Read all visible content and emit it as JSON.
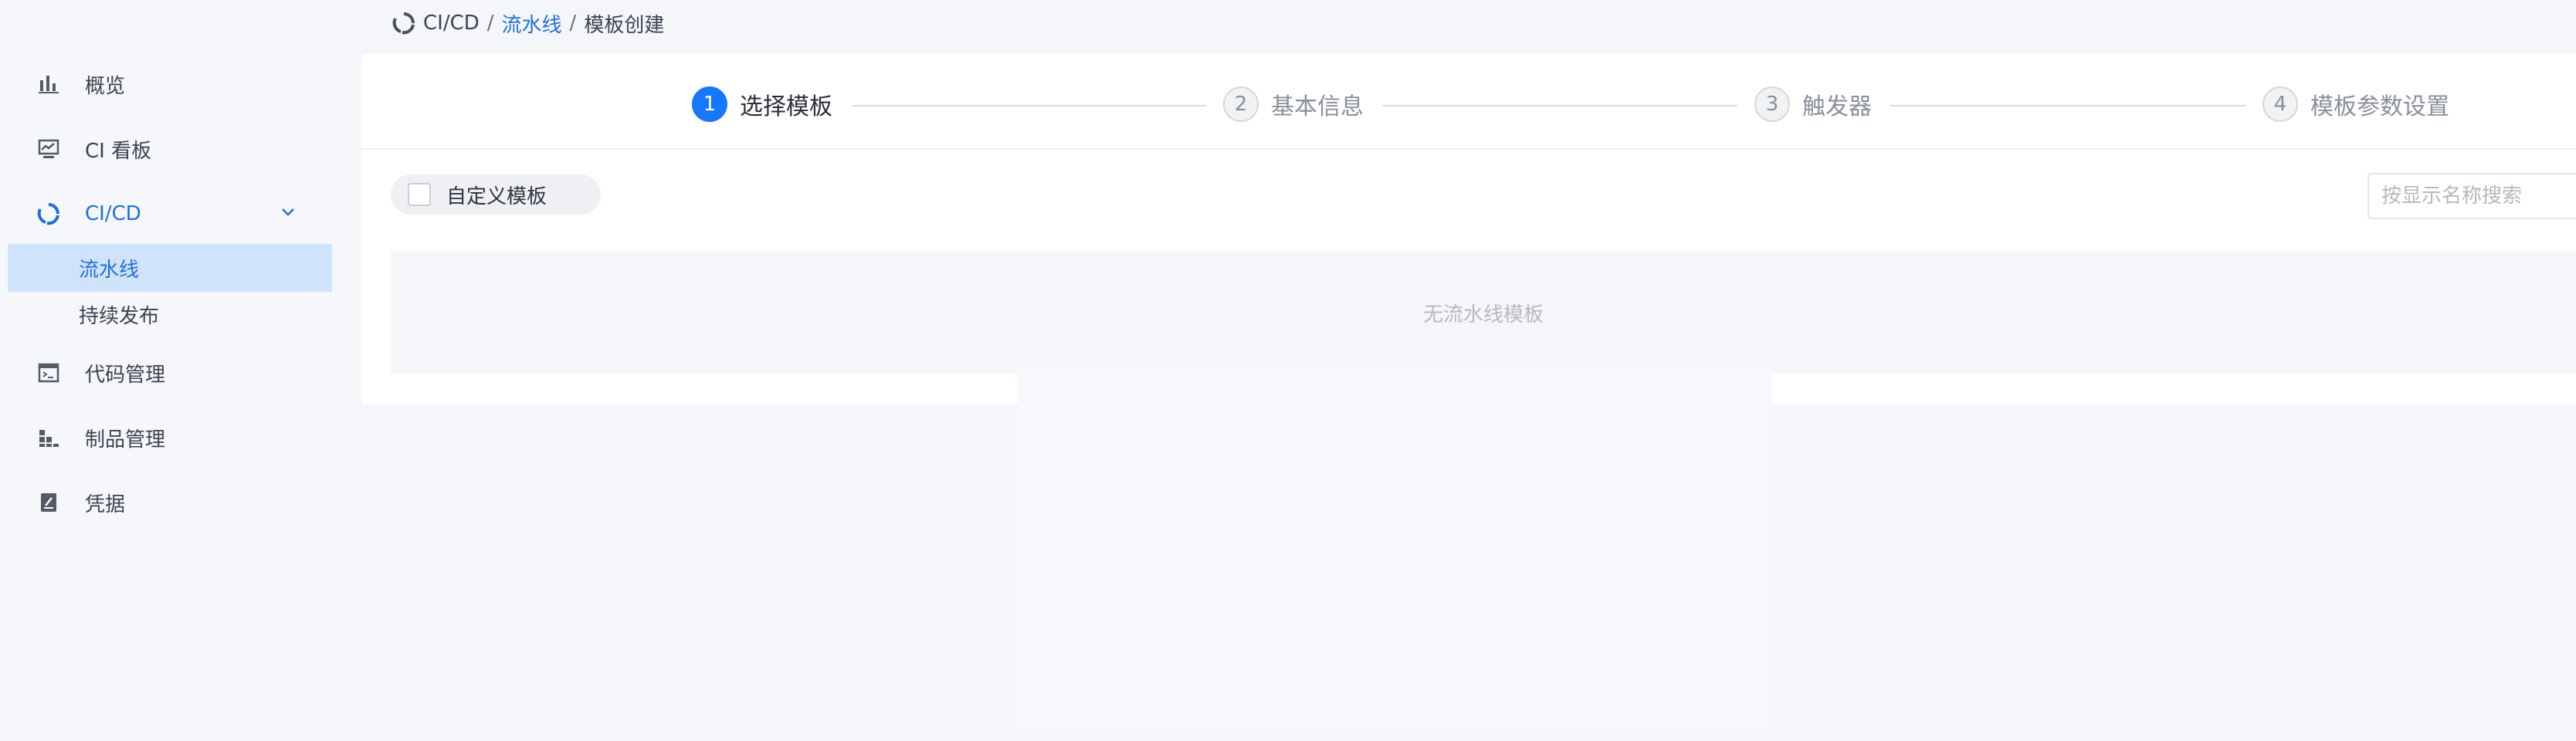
{
  "breadcrumb": {
    "root": "CI/CD",
    "sep": "/",
    "pipelines": "流水线",
    "current": "模板创建"
  },
  "sidebar": {
    "items": [
      {
        "label": "概览",
        "icon": "bar-chart-icon"
      },
      {
        "label": "CI 看板",
        "icon": "dashboard-icon"
      },
      {
        "label": "CI/CD",
        "icon": "cicd-ring-icon",
        "expanded": true
      },
      {
        "label": "代码管理",
        "icon": "terminal-icon"
      },
      {
        "label": "制品管理",
        "icon": "artifact-blocks-icon"
      },
      {
        "label": "凭据",
        "icon": "credential-icon"
      }
    ],
    "subitems": [
      {
        "label": "流水线",
        "active": true
      },
      {
        "label": "持续发布",
        "active": false
      }
    ]
  },
  "steps": [
    {
      "num": "1",
      "label": "选择模板",
      "active": true
    },
    {
      "num": "2",
      "label": "基本信息",
      "active": false
    },
    {
      "num": "3",
      "label": "触发器",
      "active": false
    },
    {
      "num": "4",
      "label": "模板参数设置",
      "active": false
    }
  ],
  "toolbar": {
    "custom_template_label": "自定义模板",
    "custom_template_checked": false,
    "search_placeholder": "按显示名称搜索"
  },
  "empty_text": "无流水线模板",
  "colors": {
    "accent": "#1677ff",
    "link": "#1f6fe0",
    "active_bg": "#cfe4fb"
  }
}
